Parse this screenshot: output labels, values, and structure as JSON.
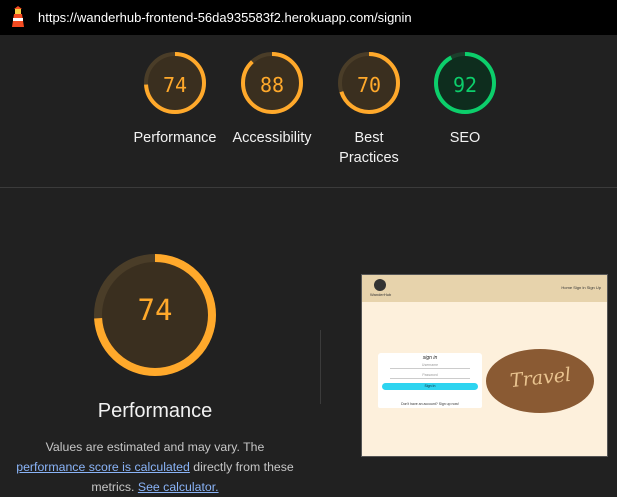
{
  "browser": {
    "url": "https://wanderhub-frontend-56da935583f2.herokuapp.com/signin"
  },
  "categories": [
    {
      "score": "74",
      "label_line1": "Performance",
      "label_line2": "",
      "status_color": "#ffa92b"
    },
    {
      "score": "88",
      "label_line1": "Accessibility",
      "label_line2": "",
      "status_color": "#ffa92b"
    },
    {
      "score": "70",
      "label_line1": "Best",
      "label_line2": "Practices",
      "status_color": "#ffa92b"
    },
    {
      "score": "92",
      "label_line1": "SEO",
      "label_line2": "",
      "status_color": "#0cce6b"
    }
  ],
  "performance": {
    "score": "74",
    "title": "Performance",
    "desc_part1": "Values are estimated and may vary. The ",
    "desc_link1": "performance score is calculated",
    "desc_part2": " directly from these metrics. ",
    "desc_link2": "See calculator."
  },
  "screenshot": {
    "logo_text": "WanderHub",
    "nav_links": "Home  Sign In  Sign Up",
    "form_title": "sign in",
    "username_placeholder": "Username",
    "password_placeholder": "Password",
    "button_label": "Sign In",
    "register_text": "Don't have an account? Sign up now!",
    "image_text": "Travel"
  },
  "colors": {
    "average": "#ffa92b",
    "pass": "#0cce6b"
  }
}
